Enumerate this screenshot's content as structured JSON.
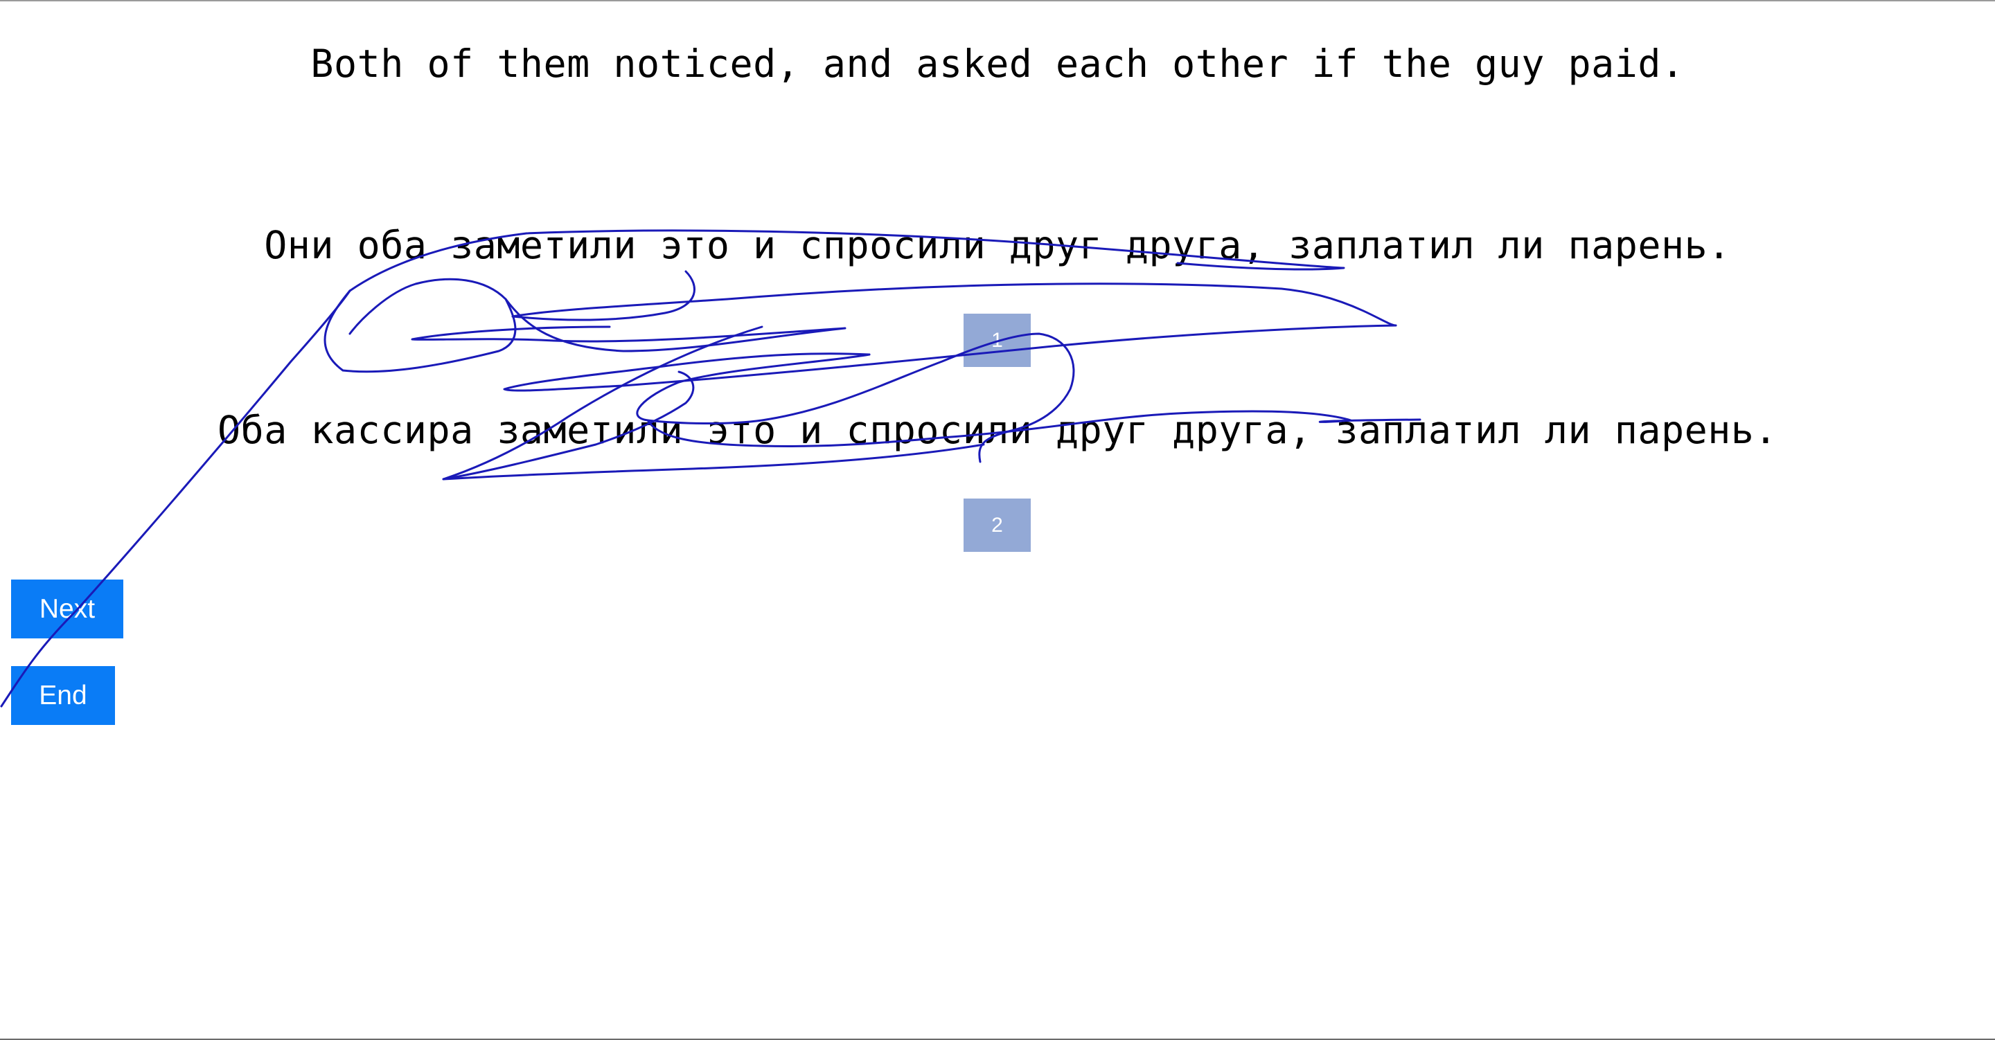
{
  "source_sentence": "Both of them noticed, and asked each other if the guy paid.",
  "options": [
    {
      "text": "Они оба заметили это и спросили друг друга, заплатил ли парень.",
      "button_label": "1"
    },
    {
      "text": "Оба кассира заметили это и спросили друг друга, заплатил ли парень.",
      "button_label": "2"
    }
  ],
  "nav": {
    "next_label": "Next",
    "end_label": "End"
  },
  "colors": {
    "choice_button": "#93a9d6",
    "nav_button": "#0a7cf6",
    "scribble_stroke": "#1a1ab8"
  }
}
